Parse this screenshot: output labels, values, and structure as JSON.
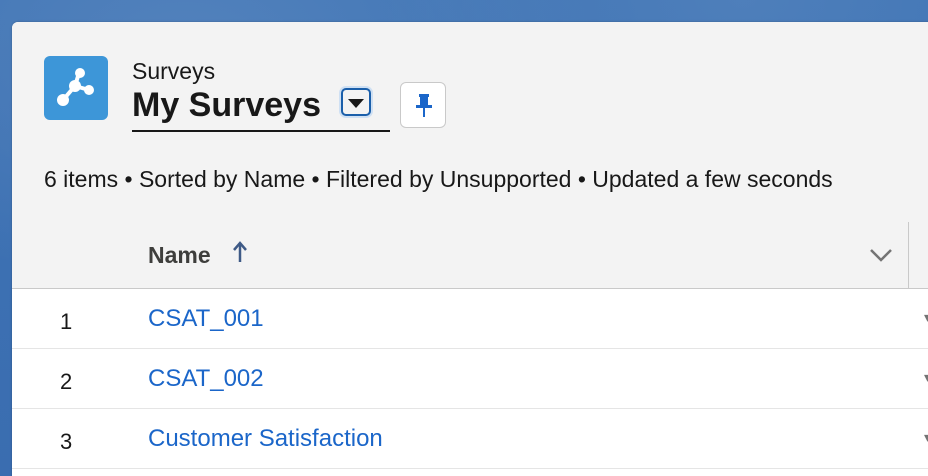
{
  "header": {
    "object_label": "Surveys",
    "list_title": "My Surveys",
    "meta": "6 items • Sorted by Name • Filtered by Unsupported • Updated a few seconds"
  },
  "table": {
    "columns": [
      {
        "label": "Name"
      }
    ],
    "rows": [
      {
        "num": "1",
        "name": "CSAT_001"
      },
      {
        "num": "2",
        "name": "CSAT_002"
      },
      {
        "num": "3",
        "name": "Customer Satisfaction"
      }
    ]
  },
  "icons": {
    "app": "survey-icon",
    "view_switch": "caret-down-icon",
    "pin": "pin-icon",
    "sort": "arrow-up-icon",
    "column_menu": "chevron-down-icon"
  },
  "colors": {
    "app_icon": "#3d96d8",
    "link": "#1b66c9",
    "pin": "#1b66c9"
  }
}
